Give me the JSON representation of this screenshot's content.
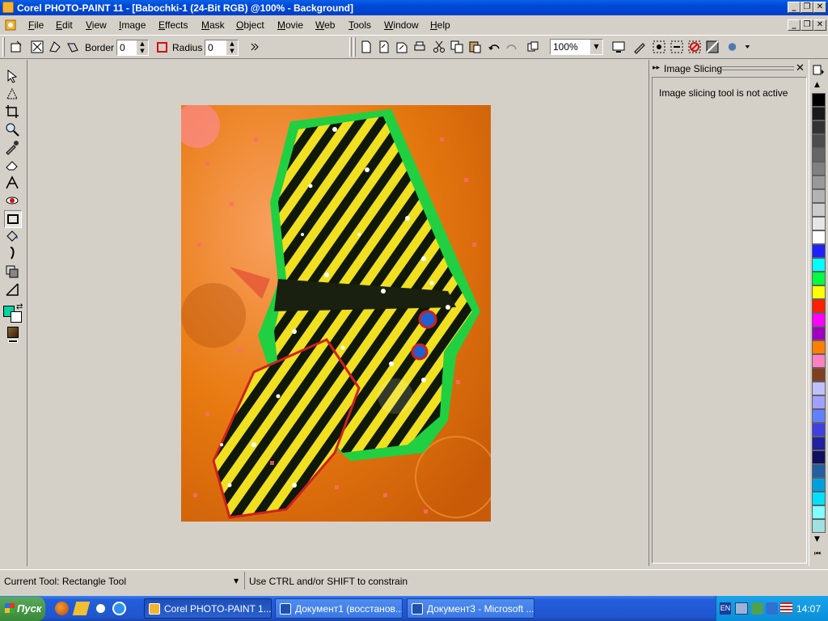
{
  "window": {
    "title": "Corel PHOTO-PAINT 11 - [Babochki-1 (24-Bit RGB) @100% - Background]"
  },
  "menu": [
    "File",
    "Edit",
    "View",
    "Image",
    "Effects",
    "Mask",
    "Object",
    "Movie",
    "Web",
    "Tools",
    "Window",
    "Help"
  ],
  "propertybar": {
    "border_label": "Border",
    "border_value": "0",
    "radius_label": "Radius",
    "radius_value": "0",
    "zoom_value": "100%"
  },
  "docker": {
    "title": "Image Slicing",
    "message": "Image slicing tool is not active"
  },
  "status": {
    "current_tool": "Current Tool: Rectangle Tool",
    "hint": "Use CTRL and/or SHIFT to constrain"
  },
  "taskbar": {
    "start_label": "Пуск",
    "tasks": [
      {
        "label": "Corel PHOTO-PAINT 1..."
      },
      {
        "label": "Документ1 (восстанов..."
      },
      {
        "label": "Документ3 - Microsoft ..."
      }
    ],
    "tray": {
      "lang": "EN",
      "clock": "14:07"
    }
  },
  "colors": {
    "primary": "#00d4a0",
    "secondary": "#ffffff",
    "palette": [
      "#000000",
      "#1a1a1a",
      "#333333",
      "#4d4d4d",
      "#666666",
      "#808080",
      "#999999",
      "#b3b3b3",
      "#cccccc",
      "#e6e6e6",
      "#ffffff",
      "#2020ff",
      "#00ffff",
      "#00ff40",
      "#ffff00",
      "#ff2000",
      "#ff00ff",
      "#a000c0",
      "#ff8000",
      "#ff80c0",
      "#804020",
      "#c0c0ff",
      "#a0a0ff",
      "#6080ff",
      "#4040e0",
      "#2020a0",
      "#101060",
      "#2060a0",
      "#00a0e0",
      "#00e0ff",
      "#80ffff",
      "#a0e0e0"
    ]
  },
  "icons": {
    "tools": [
      "pick-tool-icon",
      "mask-transform-icon",
      "crop-tool-icon",
      "zoom-tool-icon",
      "eyedropper-tool-icon",
      "eraser-tool-icon",
      "text-tool-icon",
      "red-eye-icon",
      "rectangle-tool-icon",
      "fill-tool-icon",
      "paint-tool-icon",
      "effect-tool-icon",
      "clone-tool-icon"
    ]
  }
}
